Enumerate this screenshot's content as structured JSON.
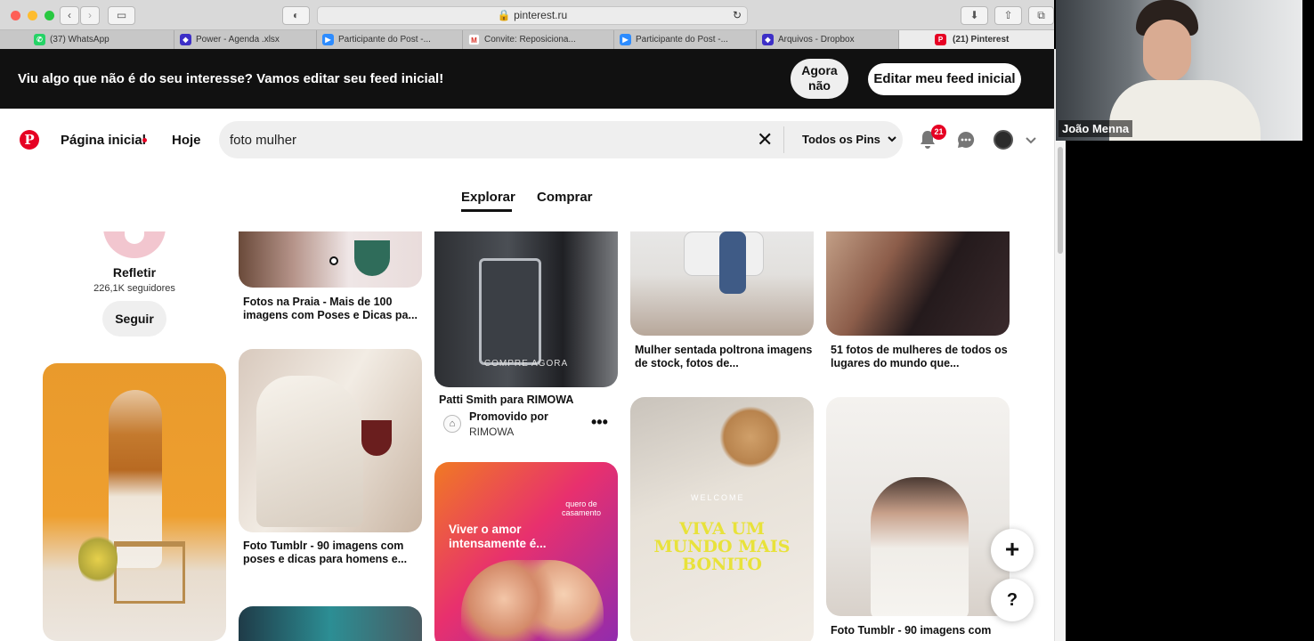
{
  "browser": {
    "url": "pinterest.ru",
    "tabs": [
      {
        "label": "(37) WhatsApp",
        "icon": "whatsapp-icon"
      },
      {
        "label": "Power - Agenda .xlsx",
        "icon": "dropbox-icon"
      },
      {
        "label": "Participante do Post -...",
        "icon": "zoom-icon"
      },
      {
        "label": "Convite: Reposiciona...",
        "icon": "gmail-icon"
      },
      {
        "label": "Participante do Post -...",
        "icon": "zoom-icon"
      },
      {
        "label": "Arquivos - Dropbox",
        "icon": "dropbox-icon"
      },
      {
        "label": "(21) Pinterest",
        "icon": "pinterest-icon"
      }
    ]
  },
  "banner": {
    "text": "Viu algo que não é do seu interesse? Vamos editar seu feed inicial!",
    "now_line1": "Agora",
    "now_line2": "não",
    "edit_label": "Editar meu feed inicial"
  },
  "header": {
    "home_label": "Página inicial",
    "today_label": "Hoje",
    "search_value": "foto mulher",
    "filter_label": "Todos os Pins",
    "notification_count": "21"
  },
  "tabs": {
    "explore": "Explorar",
    "shop": "Comprar"
  },
  "profile_card": {
    "name": "Refletir",
    "followers": "226,1K seguidores",
    "follow_label": "Seguir"
  },
  "pins": [
    {
      "title": "Fotos na Praia - Mais de 100 imagens com Poses e Dicas pa..."
    },
    {
      "title": "Foto Tumblr - 90 imagens com poses e dicas para homens e..."
    },
    {
      "title": "Patti Smith para RIMOWA",
      "image_caption": "COMPRE AGORA",
      "promoted_label": "Promovido por",
      "promoted_by": "RIMOWA"
    },
    {
      "title": "Mulher sentada poltrona imagens de stock, fotos de..."
    },
    {
      "title": "51 fotos de mulheres de todos os lugares do mundo que..."
    },
    {
      "title": "Foto Tumblr - 90 imagens com"
    },
    {
      "overlay_text": "Viver o amor intensamente é...",
      "brand": "quero de casamento"
    },
    {
      "overlay_text": "VIVA UM MUNDO MAIS BONITO",
      "overlay_small": "WELCOME"
    }
  ],
  "fab": {
    "add_label": "+",
    "help_label": "?"
  },
  "video": {
    "participant_name": "João Menna"
  }
}
